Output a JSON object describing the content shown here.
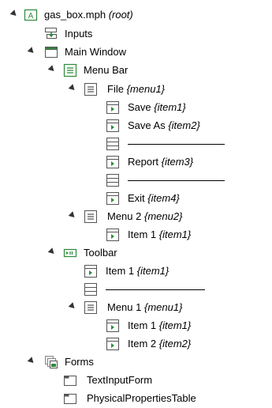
{
  "tree": {
    "root": {
      "label": "gas_box.mph",
      "tag": "(root)"
    },
    "inputs": {
      "label": "Inputs"
    },
    "main_window": {
      "label": "Main Window"
    },
    "menu_bar": {
      "label": "Menu Bar"
    },
    "file_menu": {
      "label": "File",
      "tag": "{menu1}"
    },
    "save": {
      "label": "Save",
      "tag": "{item1}"
    },
    "save_as": {
      "label": "Save As",
      "tag": "{item2}"
    },
    "report": {
      "label": "Report",
      "tag": "{item3}"
    },
    "exit": {
      "label": "Exit",
      "tag": "{item4}"
    },
    "menu2": {
      "label": "Menu 2",
      "tag": "{menu2}"
    },
    "menu2_item1": {
      "label": "Item 1",
      "tag": "{item1}"
    },
    "toolbar": {
      "label": "Toolbar"
    },
    "toolbar_item1": {
      "label": "Item 1",
      "tag": "{item1}"
    },
    "toolbar_menu1": {
      "label": "Menu 1",
      "tag": "{menu1}"
    },
    "toolbar_menu1_item1": {
      "label": "Item 1",
      "tag": "{item1}"
    },
    "toolbar_menu1_item2": {
      "label": "Item 2",
      "tag": "{item2}"
    },
    "forms": {
      "label": "Forms"
    },
    "text_input_form": {
      "label": "TextInputForm"
    },
    "physical_properties_table": {
      "label": "PhysicalPropertiesTable"
    }
  },
  "icons": {
    "root": "root-app-icon",
    "inputs": "inputs-icon",
    "main_window": "window-icon",
    "menu": "menu-icon",
    "menu_item": "menu-item-icon",
    "separator": "separator-icon",
    "toolbar": "toolbar-icon",
    "forms": "forms-icon",
    "form": "form-icon"
  },
  "colors": {
    "icon_green": "#2e8b3a",
    "icon_border": "#555555"
  }
}
